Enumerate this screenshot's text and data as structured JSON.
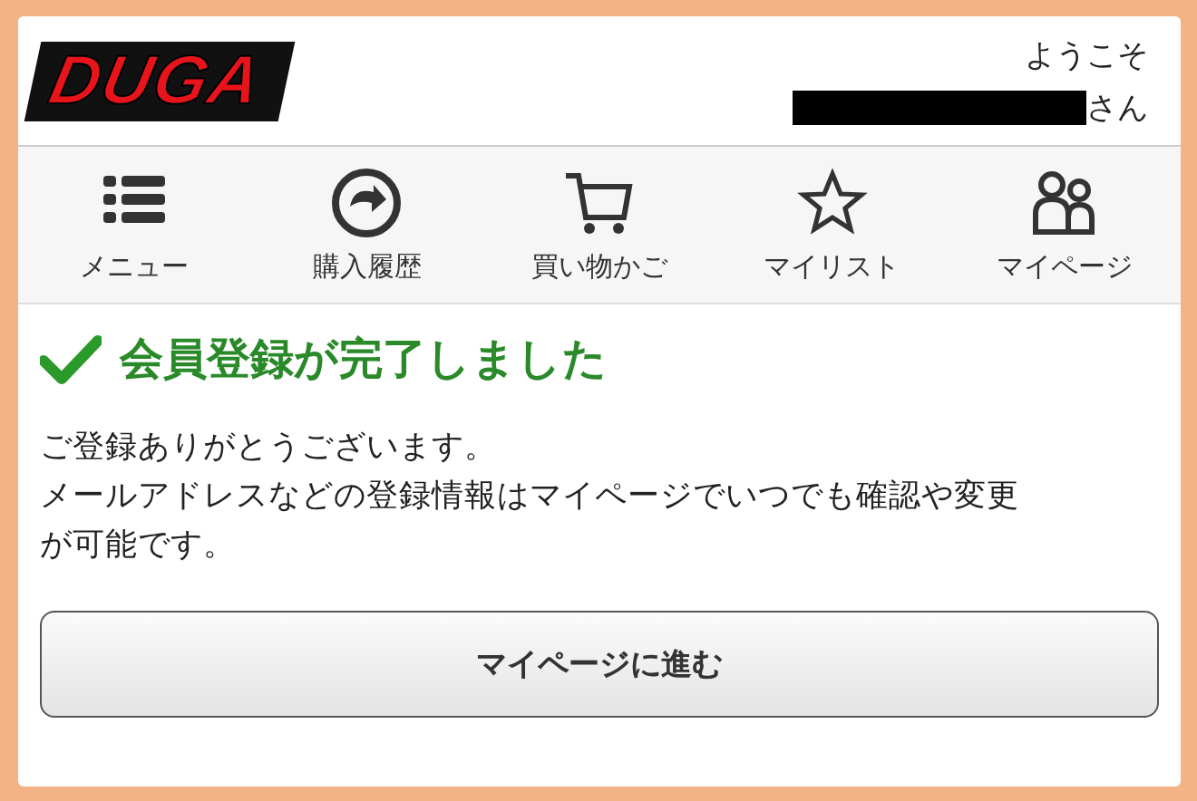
{
  "header": {
    "logo": "DUGA",
    "greeting": "ようこそ",
    "user_suffix": "さん",
    "user_redacted": true
  },
  "nav": [
    {
      "label": "メニュー"
    },
    {
      "label": "購入履歴"
    },
    {
      "label": "買い物かご"
    },
    {
      "label": "マイリスト"
    },
    {
      "label": "マイページ"
    }
  ],
  "message": {
    "title": "会員登録が完了しました",
    "lines": [
      "ご登録ありがとうございます。",
      "メールアドレスなどの登録情報はマイページでいつでも確認や変更が可能です。"
    ]
  },
  "button": "マイページに進む"
}
